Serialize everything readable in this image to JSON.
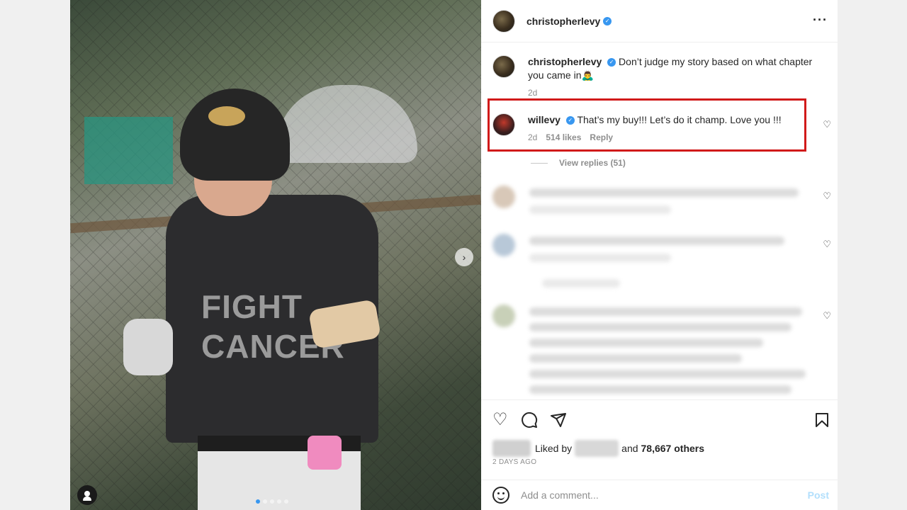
{
  "post": {
    "author": "christopherlevy",
    "caption": "Don’t judge my story based on what chapter you came in🙇‍♂️",
    "caption_time": "2d"
  },
  "header": {
    "username": "christopherlevy",
    "more_icon": "more-options-icon"
  },
  "highlighted_comment": {
    "username": "willevy",
    "text": "That’s my buy!!! Let’s do it champ. Love you !!!",
    "time": "2d",
    "likes": "514 likes",
    "reply": "Reply"
  },
  "view_replies": "View replies (51)",
  "actions": {
    "like_icon": "heart-icon",
    "comment_icon": "comment-icon",
    "share_icon": "share-icon",
    "save_icon": "bookmark-icon"
  },
  "likes_line": {
    "prefix": "Liked by",
    "middle": "and",
    "count": "78,667 others"
  },
  "time_ago": "2 DAYS AGO",
  "add_comment": {
    "placeholder": "Add a comment...",
    "post": "Post"
  },
  "photo": {
    "shirt_line1": "FIGHT",
    "shirt_line2": "CANCER"
  },
  "colors": {
    "verified": "#3897f0",
    "highlight_border": "#d11a1a",
    "post_disabled": "#b2dffc"
  }
}
